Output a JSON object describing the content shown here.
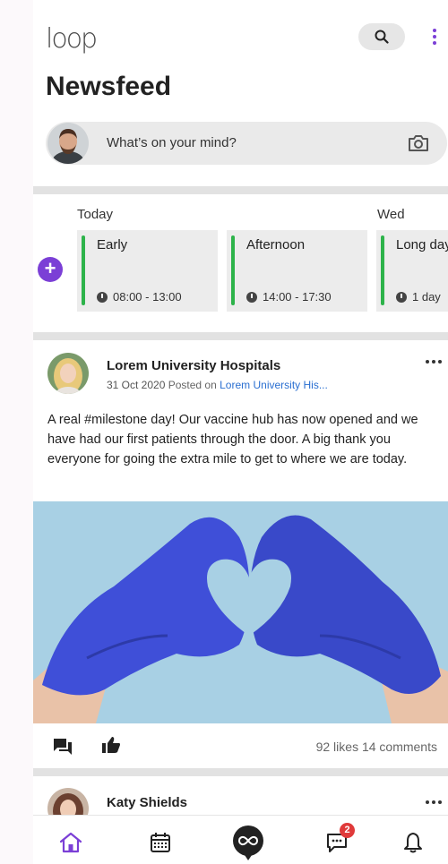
{
  "header": {
    "logo": "loop",
    "title": "Newsfeed",
    "composer_placeholder": "What’s on your mind?"
  },
  "shifts": {
    "days": [
      "Today",
      "Wed"
    ],
    "cards": [
      {
        "name": "Early",
        "time": "08:00 - 13:00"
      },
      {
        "name": "Afternoon",
        "time": "14:00 - 17:30"
      },
      {
        "name": "Long day",
        "time": "1 day"
      }
    ],
    "add_label": "+"
  },
  "post": {
    "author": "Lorem University Hospitals",
    "date": "31 Oct 2020",
    "posted_on_label": "Posted on",
    "posted_on_link": "Lorem University His...",
    "body": "A real #milestone day! Our vaccine hub has now opened and we have had our first patients through the door. A big thank you everyone for going the extra mile to get to where we are today.",
    "likes": "92 likes",
    "comments": "14 comments"
  },
  "next_post": {
    "author": "Katy Shields"
  },
  "tabbar": {
    "chat_badge": "2"
  },
  "colors": {
    "accent": "#7b3fd6",
    "shift_bar": "#2db34a",
    "link": "#2a6fd1",
    "badge": "#e03a3a",
    "glove": "#3f4fd8"
  }
}
